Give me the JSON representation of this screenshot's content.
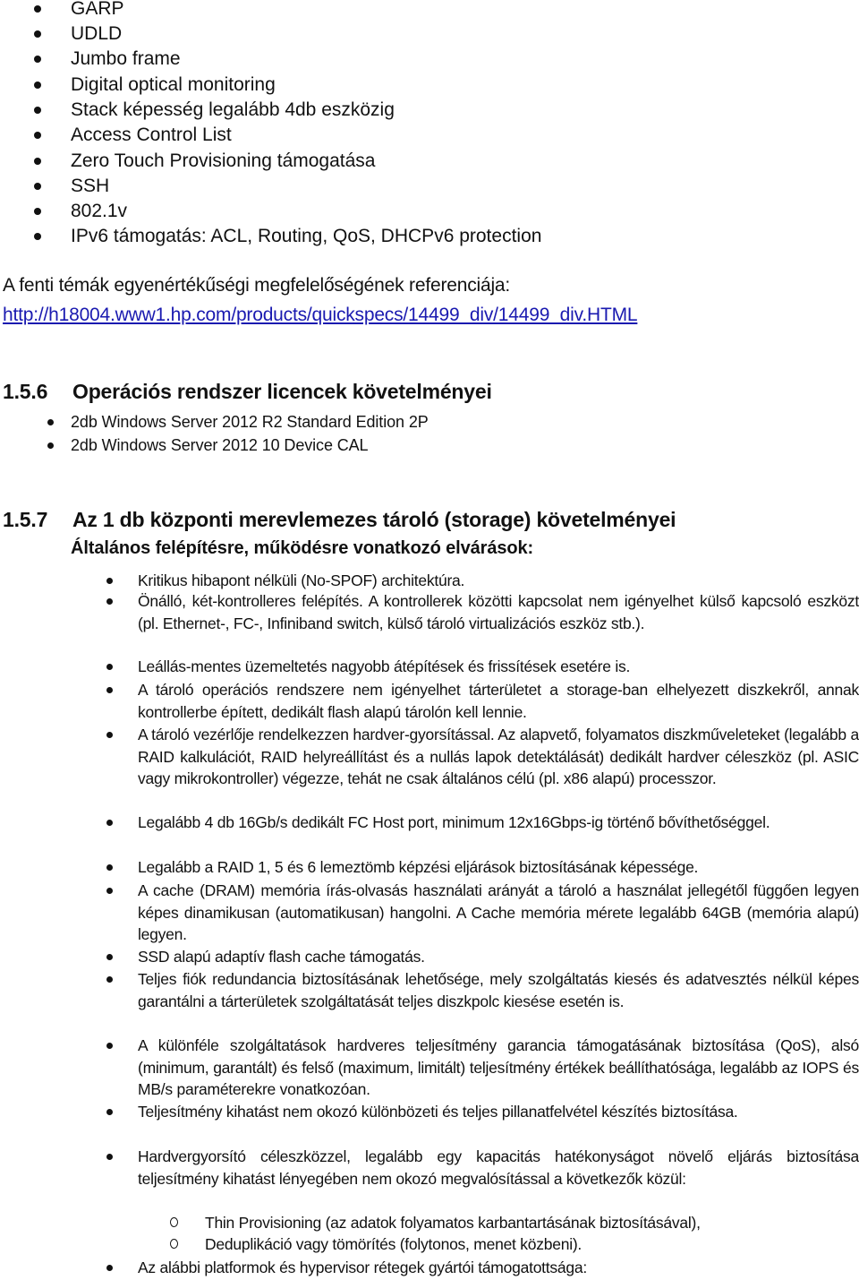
{
  "top_bullets": [
    "GARP",
    "UDLD",
    "Jumbo frame",
    "Digital optical monitoring",
    "Stack képesség legalább 4db eszközig",
    "Access Control List",
    "Zero Touch Provisioning támogatása",
    "SSH",
    "802.1v",
    "IPv6 támogatás: ACL, Routing, QoS, DHCPv6 protection"
  ],
  "reference": {
    "text": "A fenti témák egyenértékűségi megfelelőségének referenciája:",
    "link": "http://h18004.www1.hp.com/products/quickspecs/14499_div/14499_div.HTML",
    "link_color": "#1a1ab0"
  },
  "section_156": {
    "number": "1.5.6",
    "title": "Operációs rendszer licencek követelményei",
    "items": [
      "2db Windows Server 2012 R2 Standard Edition 2P",
      "2db Windows Server 2012 10 Device CAL"
    ]
  },
  "section_157": {
    "number": "1.5.7",
    "title": "Az 1 db központi merevlemezes tároló (storage) követelményei",
    "subtitle": "Általános felépítésre, működésre vonatkozó elvárások:",
    "items": [
      "Kritikus hibapont nélküli (No-SPOF) architektúra.",
      "Önálló, két-kontrolleres felépítés. A kontrollerek közötti kapcsolat nem igényelhet külső kapcsoló eszközt (pl. Ethernet-, FC-, Infiniband switch, külső tároló virtualizációs eszköz stb.).",
      "Leállás-mentes üzemeltetés nagyobb átépítések és frissítések esetére is.",
      "A tároló operációs rendszere nem igényelhet tárterületet a storage-ban elhelyezett diszkekről, annak kontrollerbe épített, dedikált flash alapú tárolón kell lennie.",
      "A tároló vezérlője rendelkezzen hardver-gyorsítással. Az alapvető, folyamatos diszkműveleteket (legalább a RAID kalkulációt, RAID helyreállítást és a nullás lapok detektálását) dedikált hardver céleszköz (pl. ASIC vagy mikrokontroller) végezze, tehát ne csak általános célú (pl. x86 alapú) processzor.",
      "Legalább 4 db 16Gb/s dedikált FC Host port, minimum 12x16Gbps-ig történő bővíthetőséggel.",
      "Legalább a RAID 1, 5 és 6 lemeztömb képzési eljárások biztosításának képessége.",
      "A cache (DRAM) memória írás-olvasás használati arányát a tároló a használat jellegétől függően legyen képes dinamikusan (automatikusan) hangolni. A Cache memória mérete legalább 64GB (memória alapú) legyen.",
      "SSD alapú adaptív flash cache támogatás.",
      "Teljes fiók redundancia biztosításának lehetősége, mely szolgáltatás kiesés és adatvesztés nélkül képes garantálni a tárterületek szolgáltatását teljes diszkpolc kiesése esetén is.",
      "A különféle szolgáltatások hardveres teljesítmény garancia támogatásának biztosítása (QoS), alsó (minimum, garantált) és felső (maximum, limitált) teljesítmény értékek beállíthatósága, legalább az IOPS és MB/s paraméterekre vonatkozóan.",
      "Teljesítmény kihatást nem okozó különbözeti és teljes pillanatfelvétel készítés biztosítása.",
      "Hardvergyorsító céleszközzel, legalább egy kapacitás hatékonyságot növelő eljárás biztosítása teljesítmény kihatást lényegében nem okozó megvalósítással a következők közül:"
    ],
    "sub_items": [
      "Thin Provisioning (az adatok folyamatos karbantartásának biztosításával),",
      "Deduplikáció vagy tömörítés (folytonos, menet közbeni)."
    ],
    "last_item": "Az alábbi platformok és hypervisor rétegek gyártói támogatottsága:"
  }
}
